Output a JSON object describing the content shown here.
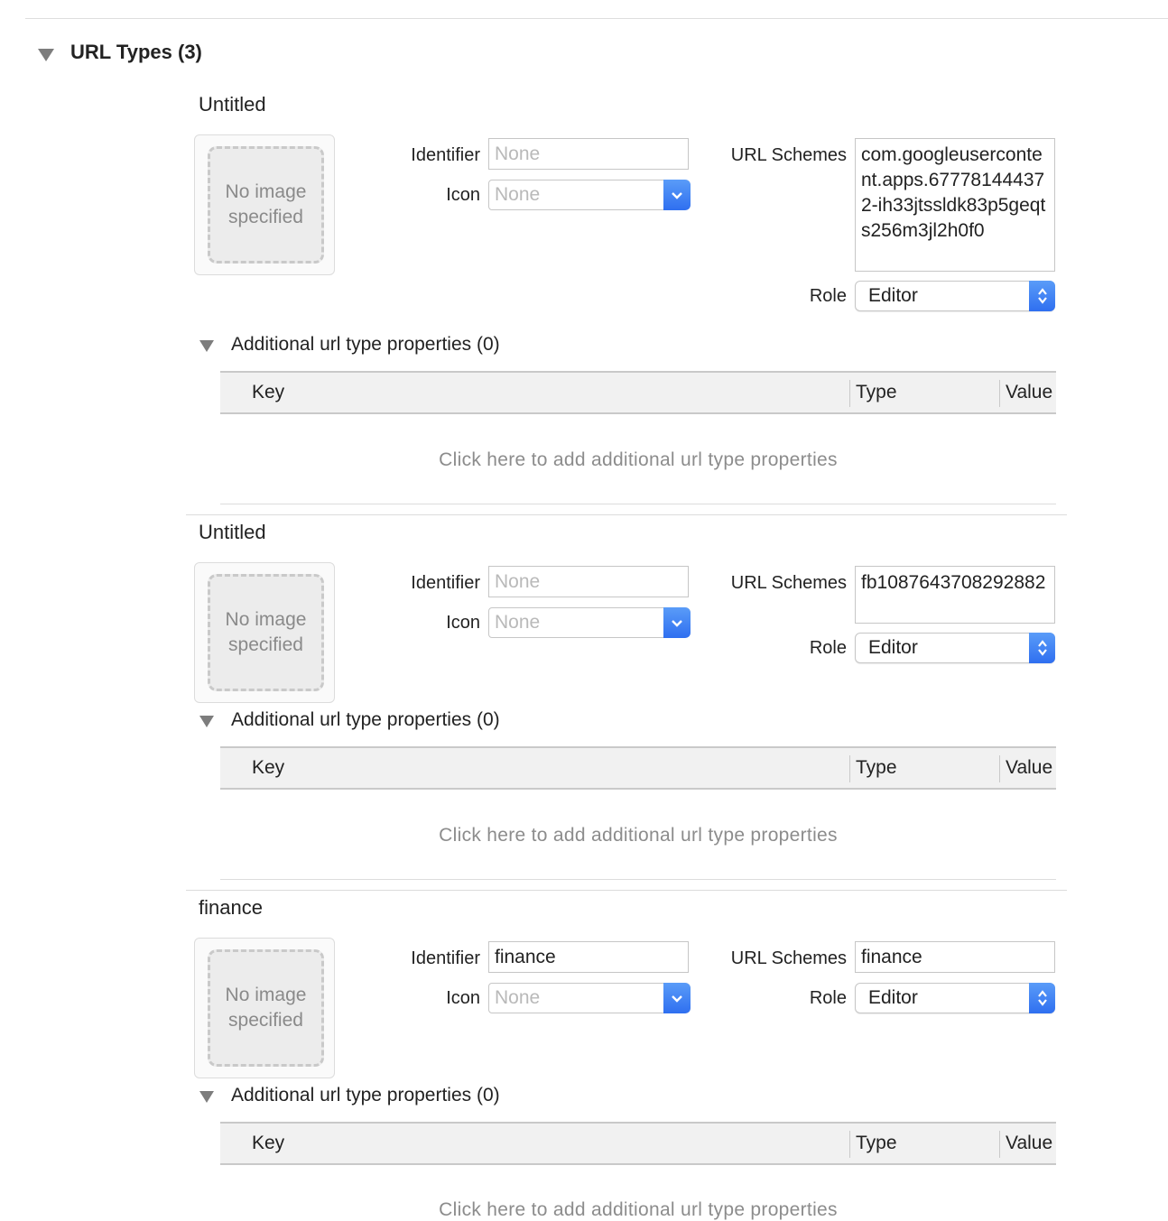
{
  "section": {
    "title": "URL Types (3)"
  },
  "labels": {
    "identifier": "Identifier",
    "icon": "Icon",
    "url_schemes": "URL Schemes",
    "role": "Role",
    "no_image": "No image specified",
    "additional": "Additional url type properties (0)",
    "col_key": "Key",
    "col_type": "Type",
    "col_value": "Value",
    "add_hint": "Click here to add additional url type properties"
  },
  "entries": [
    {
      "name": "Untitled",
      "identifier_placeholder": "None",
      "identifier": "",
      "icon_placeholder": "None",
      "url_schemes": "com.googleusercontent.apps.677781444372-ih33jtssldk83p5geqts256m3jl2h0f0",
      "role": "Editor"
    },
    {
      "name": "Untitled",
      "identifier_placeholder": "None",
      "identifier": "",
      "icon_placeholder": "None",
      "url_schemes": "fb1087643708292882",
      "role": "Editor"
    },
    {
      "name": "finance",
      "identifier_placeholder": "None",
      "identifier": "finance",
      "icon_placeholder": "None",
      "url_schemes": "finance",
      "role": "Editor"
    }
  ]
}
